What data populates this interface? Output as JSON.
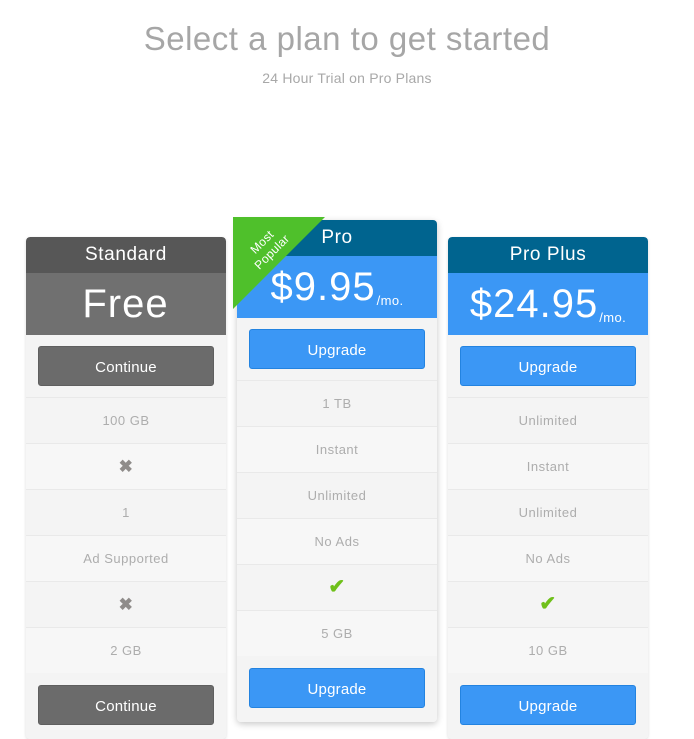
{
  "header": {
    "title": "Select a plan to get started",
    "subtitle": "24 Hour Trial on Pro Plans"
  },
  "ribbon": {
    "line1": "Most",
    "line2": "Popular"
  },
  "icons": {
    "cross": "✖",
    "check": "✔"
  },
  "colors": {
    "head_gray": "#575757",
    "head_blue": "#00648f",
    "price_gray": "#707070",
    "price_blue": "#3b97f5",
    "cta_gray": "#6b6b6b",
    "cta_blue": "#3b97f5",
    "ribbon_green": "#4fc02b",
    "check_green": "#6fc01a"
  },
  "plans": [
    {
      "name": "Standard",
      "price": "Free",
      "period": "",
      "cta_top": "Continue",
      "cta_bottom": "Continue",
      "featured": false,
      "features": [
        "100 GB",
        "✖",
        "1",
        "Ad Supported",
        "✖",
        "2 GB"
      ]
    },
    {
      "name": "Pro",
      "price": "$9.95",
      "period": "/mo.",
      "cta_top": "Upgrade",
      "cta_bottom": "Upgrade",
      "featured": true,
      "features": [
        "1 TB",
        "Instant",
        "Unlimited",
        "No Ads",
        "✔",
        "5 GB"
      ]
    },
    {
      "name": "Pro Plus",
      "price": "$24.95",
      "period": "/mo.",
      "cta_top": "Upgrade",
      "cta_bottom": "Upgrade",
      "featured": false,
      "features": [
        "Unlimited",
        "Instant",
        "Unlimited",
        "No Ads",
        "✔",
        "10 GB"
      ]
    }
  ]
}
